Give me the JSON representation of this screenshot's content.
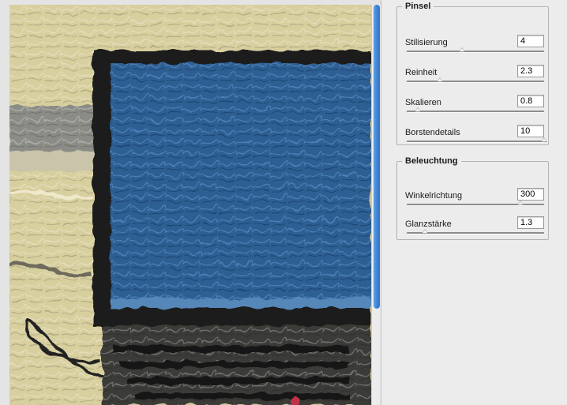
{
  "pinsel": {
    "title": "Pinsel",
    "rows": [
      {
        "label": "Stilisierung",
        "value": "4",
        "slider": 0.4
      },
      {
        "label": "Reinheit",
        "value": "2.3",
        "slider": 0.24
      },
      {
        "label": "Skalieren",
        "value": "0.8",
        "slider": 0.08
      },
      {
        "label": "Borstendetails",
        "value": "10",
        "slider": 1.0
      }
    ]
  },
  "beleuchtung": {
    "title": "Beleuchtung",
    "rows": [
      {
        "label": "Winkelrichtung",
        "value": "300",
        "slider": 0.83
      },
      {
        "label": "Glanzstärke",
        "value": "1.3",
        "slider": 0.13
      }
    ]
  },
  "preview": {
    "scroll_fraction": 0.76
  }
}
